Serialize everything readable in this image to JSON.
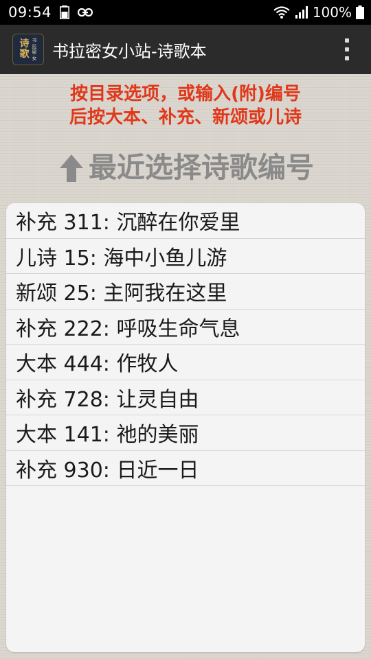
{
  "status_bar": {
    "time": "09:54",
    "battery_level": "100",
    "battery_pct": "100%"
  },
  "app_bar": {
    "logo_main": "诗歌",
    "logo_sub": "书拉密女",
    "title": "书拉密女小站-诗歌本"
  },
  "instructions": {
    "line1": "按目录选项，或输入(附)编号",
    "line2": "后按大本、补充、新颂或儿诗"
  },
  "recent_heading": "最近选择诗歌编号",
  "recent_items": [
    "补充 311: 沉醉在你爱里",
    "儿诗 15: 海中小鱼儿游",
    "新颂 25: 主阿我在这里",
    "补充 222: 呼吸生命气息",
    "大本 444: 作牧人",
    "补充 728: 让灵自由",
    "大本 141: 祂的美丽",
    "补充 930: 日近一日"
  ],
  "colors": {
    "instruction_text": "#e0381a",
    "heading_text": "#8a8a8a",
    "app_bar": "#2b2b2b"
  }
}
